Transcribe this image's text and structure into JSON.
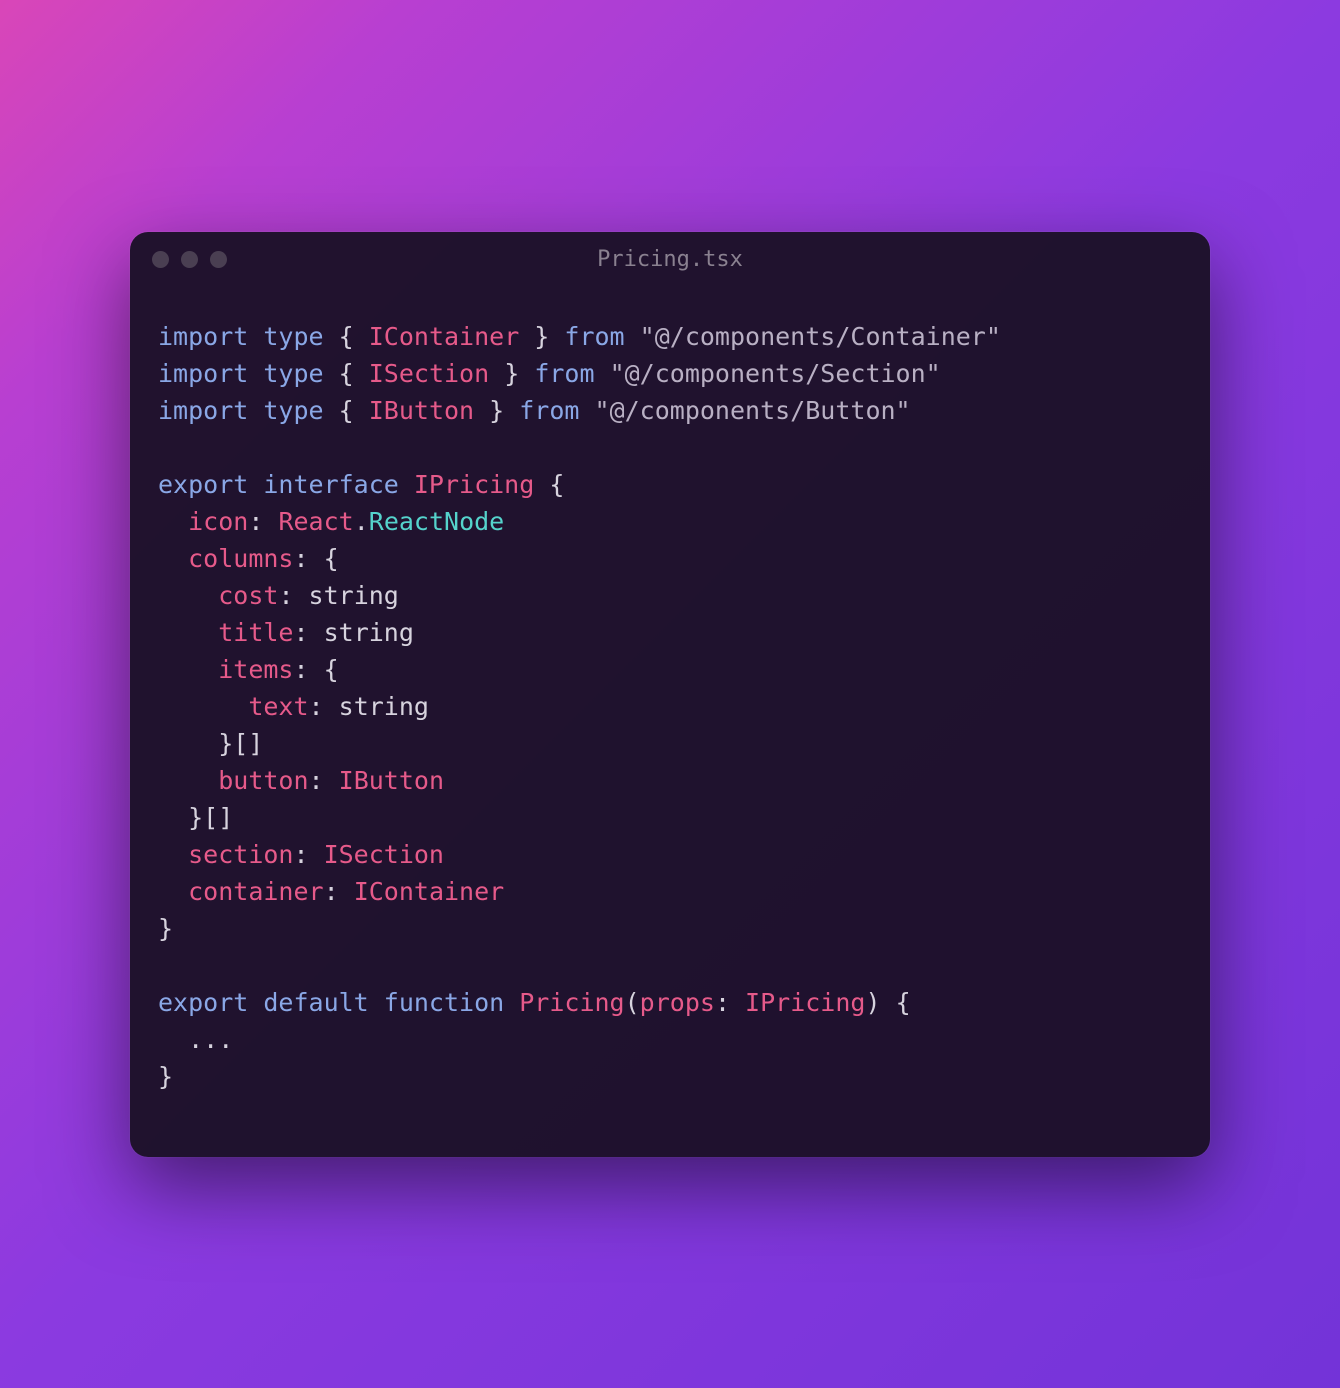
{
  "window": {
    "title": "Pricing.tsx"
  },
  "code": {
    "lines": [
      [
        {
          "t": "import ",
          "c": "tok-kw"
        },
        {
          "t": "type ",
          "c": "tok-kw"
        },
        {
          "t": "{ ",
          "c": "tok-punc"
        },
        {
          "t": "IContainer",
          "c": "tok-type"
        },
        {
          "t": " } ",
          "c": "tok-punc"
        },
        {
          "t": "from ",
          "c": "tok-kw"
        },
        {
          "t": "\"@/components/Container\"",
          "c": "tok-str"
        }
      ],
      [
        {
          "t": "import ",
          "c": "tok-kw"
        },
        {
          "t": "type ",
          "c": "tok-kw"
        },
        {
          "t": "{ ",
          "c": "tok-punc"
        },
        {
          "t": "ISection",
          "c": "tok-type"
        },
        {
          "t": " } ",
          "c": "tok-punc"
        },
        {
          "t": "from ",
          "c": "tok-kw"
        },
        {
          "t": "\"@/components/Section\"",
          "c": "tok-str"
        }
      ],
      [
        {
          "t": "import ",
          "c": "tok-kw"
        },
        {
          "t": "type ",
          "c": "tok-kw"
        },
        {
          "t": "{ ",
          "c": "tok-punc"
        },
        {
          "t": "IButton",
          "c": "tok-type"
        },
        {
          "t": " } ",
          "c": "tok-punc"
        },
        {
          "t": "from ",
          "c": "tok-kw"
        },
        {
          "t": "\"@/components/Button\"",
          "c": "tok-str"
        }
      ],
      [],
      [
        {
          "t": "export ",
          "c": "tok-kw"
        },
        {
          "t": "interface ",
          "c": "tok-kw"
        },
        {
          "t": "IPricing",
          "c": "tok-type"
        },
        {
          "t": " {",
          "c": "tok-punc"
        }
      ],
      [
        {
          "t": "  ",
          "c": ""
        },
        {
          "t": "icon",
          "c": "tok-prop"
        },
        {
          "t": ": ",
          "c": "tok-punc"
        },
        {
          "t": "React",
          "c": "tok-type"
        },
        {
          "t": ".",
          "c": "tok-punc"
        },
        {
          "t": "ReactNode",
          "c": "tok-type2"
        }
      ],
      [
        {
          "t": "  ",
          "c": ""
        },
        {
          "t": "columns",
          "c": "tok-prop"
        },
        {
          "t": ": {",
          "c": "tok-punc"
        }
      ],
      [
        {
          "t": "    ",
          "c": ""
        },
        {
          "t": "cost",
          "c": "tok-prop"
        },
        {
          "t": ": ",
          "c": "tok-punc"
        },
        {
          "t": "string",
          "c": "tok-prim"
        }
      ],
      [
        {
          "t": "    ",
          "c": ""
        },
        {
          "t": "title",
          "c": "tok-prop"
        },
        {
          "t": ": ",
          "c": "tok-punc"
        },
        {
          "t": "string",
          "c": "tok-prim"
        }
      ],
      [
        {
          "t": "    ",
          "c": ""
        },
        {
          "t": "items",
          "c": "tok-prop"
        },
        {
          "t": ": {",
          "c": "tok-punc"
        }
      ],
      [
        {
          "t": "      ",
          "c": ""
        },
        {
          "t": "text",
          "c": "tok-prop"
        },
        {
          "t": ": ",
          "c": "tok-punc"
        },
        {
          "t": "string",
          "c": "tok-prim"
        }
      ],
      [
        {
          "t": "    }[]",
          "c": "tok-punc"
        }
      ],
      [
        {
          "t": "    ",
          "c": ""
        },
        {
          "t": "button",
          "c": "tok-prop"
        },
        {
          "t": ": ",
          "c": "tok-punc"
        },
        {
          "t": "IButton",
          "c": "tok-type"
        }
      ],
      [
        {
          "t": "  }[]",
          "c": "tok-punc"
        }
      ],
      [
        {
          "t": "  ",
          "c": ""
        },
        {
          "t": "section",
          "c": "tok-prop"
        },
        {
          "t": ": ",
          "c": "tok-punc"
        },
        {
          "t": "ISection",
          "c": "tok-type"
        }
      ],
      [
        {
          "t": "  ",
          "c": ""
        },
        {
          "t": "container",
          "c": "tok-prop"
        },
        {
          "t": ": ",
          "c": "tok-punc"
        },
        {
          "t": "IContainer",
          "c": "tok-type"
        }
      ],
      [
        {
          "t": "}",
          "c": "tok-punc"
        }
      ],
      [],
      [
        {
          "t": "export ",
          "c": "tok-kw"
        },
        {
          "t": "default ",
          "c": "tok-kw"
        },
        {
          "t": "function ",
          "c": "tok-kw"
        },
        {
          "t": "Pricing",
          "c": "tok-type"
        },
        {
          "t": "(",
          "c": "tok-punc"
        },
        {
          "t": "props",
          "c": "tok-param"
        },
        {
          "t": ": ",
          "c": "tok-punc"
        },
        {
          "t": "IPricing",
          "c": "tok-type"
        },
        {
          "t": ") {",
          "c": "tok-punc"
        }
      ],
      [
        {
          "t": "  ...",
          "c": "tok-punc"
        }
      ],
      [
        {
          "t": "}",
          "c": "tok-punc"
        }
      ]
    ]
  }
}
